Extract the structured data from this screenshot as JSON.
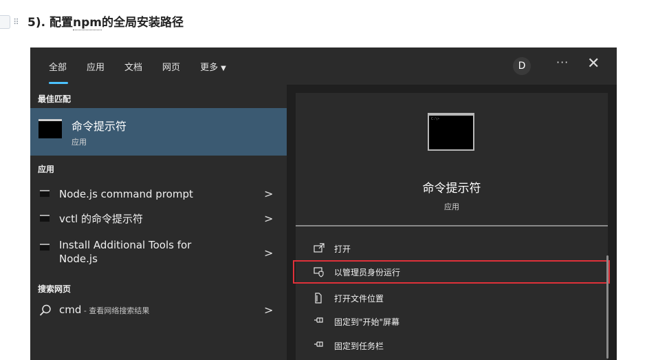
{
  "doc": {
    "heading_num": "5). ",
    "heading_a": "配置",
    "heading_npm": "npm",
    "heading_b": "的全局安装路径"
  },
  "search": {
    "tabs": [
      {
        "label": "全部"
      },
      {
        "label": "应用"
      },
      {
        "label": "文档"
      },
      {
        "label": "网页"
      },
      {
        "label": "更多"
      }
    ],
    "avatar_initial": "D",
    "more_glyph": "···",
    "close_glyph": "✕",
    "best_match_header": "最佳匹配",
    "best_match": {
      "title": "命令提示符",
      "subtitle": "应用"
    },
    "apps_header": "应用",
    "apps": [
      {
        "label": "Node.js command prompt"
      },
      {
        "label": "vctl 的命令提示符"
      },
      {
        "label": "Install Additional Tools for Node.js"
      }
    ],
    "web_header": "搜索网页",
    "web_result": {
      "query": "cmd",
      "suffix": " - 查看网络搜索结果"
    },
    "preview": {
      "title": "命令提示符",
      "subtitle": "应用"
    },
    "actions": [
      {
        "label": "打开",
        "icon": "open-icon"
      },
      {
        "label": "以管理员身份运行",
        "icon": "shield-icon",
        "highlighted": true
      },
      {
        "label": "打开文件位置",
        "icon": "file-location-icon"
      },
      {
        "label": "固定到\"开始\"屏幕",
        "icon": "pin-icon"
      },
      {
        "label": "固定到任务栏",
        "icon": "pin-icon"
      }
    ],
    "highlight_color": "#e0313a",
    "accent_color": "#4cc2ff",
    "selection_color": "#3b5a72"
  }
}
